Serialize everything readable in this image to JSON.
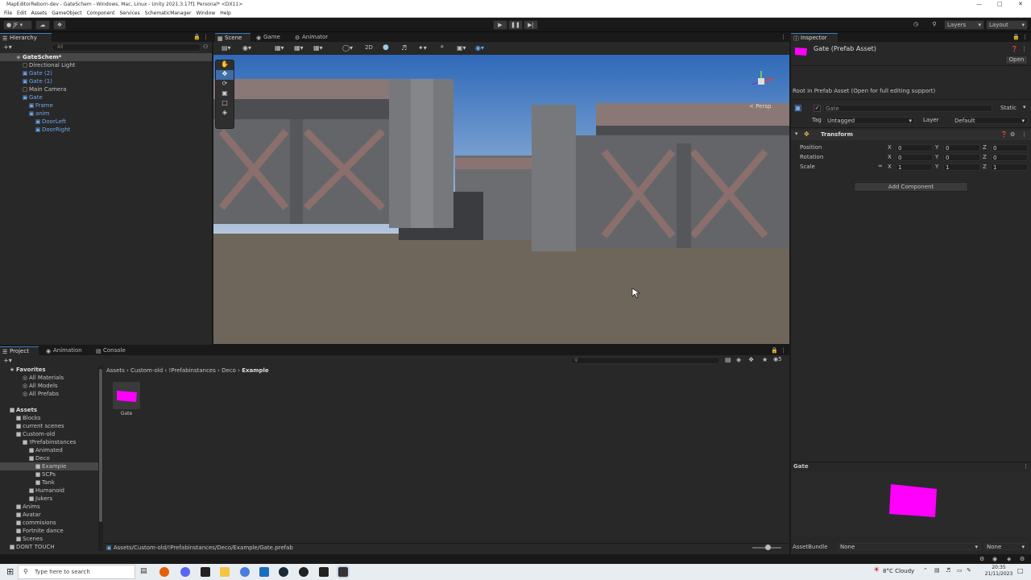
{
  "window": {
    "title": "MapEditorReborn-dev - GateSchem - Windows, Mac, Linux - Unity 2021.3.17f1 Personal* <DX11>"
  },
  "menu": [
    "File",
    "Edit",
    "Assets",
    "GameObject",
    "Component",
    "Services",
    "SchematicManager",
    "Window",
    "Help"
  ],
  "toolbar": {
    "account": "JF",
    "layers_label": "Layers",
    "layout_label": "Layout"
  },
  "hierarchy": {
    "tab": "Hierarchy",
    "search_placeholder": "All",
    "items": [
      {
        "label": "GateSchem*",
        "depth": 0,
        "color": "white"
      },
      {
        "label": "Directional Light",
        "depth": 1,
        "color": "normal"
      },
      {
        "label": "Gate (2)",
        "depth": 1,
        "color": "blue"
      },
      {
        "label": "Gate (1)",
        "depth": 1,
        "color": "blue"
      },
      {
        "label": "Main Camera",
        "depth": 1,
        "color": "normal"
      },
      {
        "label": "Gate",
        "depth": 1,
        "color": "blue"
      },
      {
        "label": "Frame",
        "depth": 2,
        "color": "blue"
      },
      {
        "label": "anim",
        "depth": 2,
        "color": "blue"
      },
      {
        "label": "DoorLeft",
        "depth": 3,
        "color": "blue"
      },
      {
        "label": "DoorRight",
        "depth": 3,
        "color": "blue"
      }
    ]
  },
  "scene": {
    "tabs": [
      "Scene",
      "Game",
      "Animator"
    ],
    "toolbar_2d": "2D",
    "gizmo_label": "< Persp"
  },
  "project": {
    "tabs": [
      "Project",
      "Animation",
      "Console"
    ],
    "search_placeholder": "",
    "breadcrumb": [
      "Assets",
      "Custom-old",
      "!Prefabinstances",
      "Deco",
      "Example"
    ],
    "favorites_label": "Favorites",
    "favorites": [
      "All Materials",
      "All Models",
      "All Prefabs"
    ],
    "assets_label": "Assets",
    "tree": [
      {
        "label": "Blocks",
        "depth": 1
      },
      {
        "label": "current scenes",
        "depth": 1
      },
      {
        "label": "Custom-old",
        "depth": 1
      },
      {
        "label": "!Prefabinstances",
        "depth": 2
      },
      {
        "label": "Animated",
        "depth": 3
      },
      {
        "label": "Deco",
        "depth": 3
      },
      {
        "label": "Example",
        "depth": 4
      },
      {
        "label": "SCPs",
        "depth": 4
      },
      {
        "label": "Tank",
        "depth": 4
      },
      {
        "label": "Humanoid",
        "depth": 3
      },
      {
        "label": "Jukers",
        "depth": 3
      },
      {
        "label": "Anims",
        "depth": 1
      },
      {
        "label": "Avatar",
        "depth": 1
      },
      {
        "label": "commisions",
        "depth": 1
      },
      {
        "label": "Fortnite dance",
        "depth": 1
      },
      {
        "label": "Scenes",
        "depth": 1
      },
      {
        "label": "DONT TOUCH",
        "depth": 0
      }
    ],
    "asset_name": "Gate",
    "status_path": "Assets/Custom-old/!Prefabinstances/Deco/Example/Gate.prefab",
    "hidden_count": "5"
  },
  "inspector": {
    "tab": "Inspector",
    "title": "Gate (Prefab Asset)",
    "open_button": "Open",
    "note": "Root in Prefab Asset (Open for full editing support)",
    "object_name": "Gate",
    "static_label": "Static",
    "tag_label": "Tag",
    "tag_value": "Untagged",
    "layer_label": "Layer",
    "layer_value": "Default",
    "component_title": "Transform",
    "position_label": "Position",
    "rotation_label": "Rotation",
    "scale_label": "Scale",
    "axis_x": "X",
    "axis_y": "Y",
    "axis_z": "Z",
    "position": [
      "0",
      "0",
      "0"
    ],
    "rotation": [
      "0",
      "0",
      "0"
    ],
    "scale": [
      "1",
      "1",
      "1"
    ],
    "add_component": "Add Component",
    "preview_title": "Gate",
    "assetbundle_label": "AssetBundle",
    "assetbundle_value": "None",
    "assetbundle_variant": "None"
  },
  "taskbar": {
    "search_placeholder": "Type here to search",
    "weather": "8°C Cloudy",
    "time": "20:35",
    "date": "21/11/2023"
  },
  "colors": {
    "prefab_magenta": "#ff00ff",
    "prefab_blue": "#6fa8ee",
    "selection": "#2c5d87",
    "accent": "#3a79bb"
  }
}
